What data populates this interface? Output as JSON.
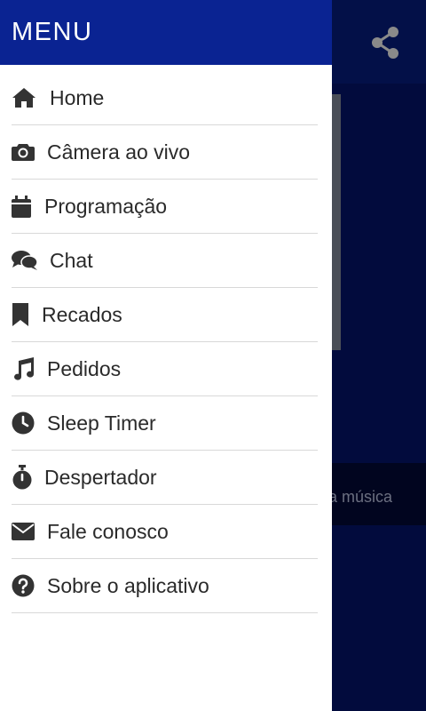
{
  "drawer": {
    "title": "MENU",
    "items": [
      {
        "label": "Home",
        "icon": "home-icon"
      },
      {
        "label": "Câmera ao vivo",
        "icon": "camera-icon"
      },
      {
        "label": "Programação",
        "icon": "calendar-icon"
      },
      {
        "label": "Chat",
        "icon": "chat-icon"
      },
      {
        "label": "Recados",
        "icon": "bookmark-icon"
      },
      {
        "label": "Pedidos",
        "icon": "music-note-icon"
      },
      {
        "label": "Sleep Timer",
        "icon": "clock-icon"
      },
      {
        "label": "Despertador",
        "icon": "stopwatch-icon"
      },
      {
        "label": "Fale conosco",
        "icon": "envelope-icon"
      },
      {
        "label": "Sobre o aplicativo",
        "icon": "help-circle-icon"
      }
    ]
  },
  "background": {
    "banner_text": "a música",
    "share_icon": "share-icon"
  },
  "colors": {
    "drawer_header": "#0a2392",
    "background": "#020b3d",
    "icon": "#333333",
    "text": "#2a2a2a"
  }
}
